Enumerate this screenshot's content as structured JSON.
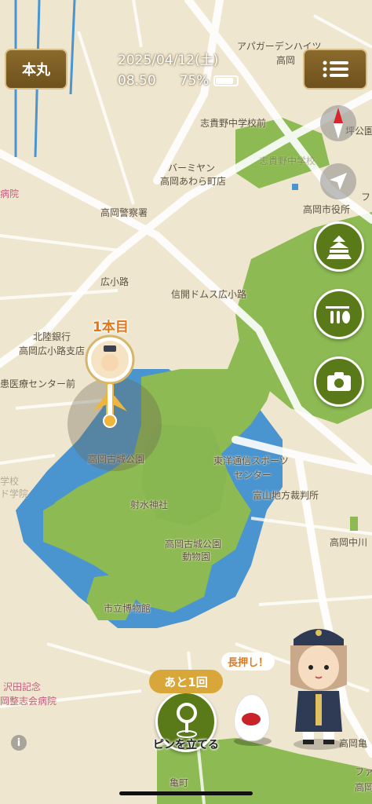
{
  "header": {
    "left_button_label": "本丸",
    "date": "2025/04/12(土)",
    "time": "08.50",
    "battery": "75%",
    "menu_icon": "list-icon"
  },
  "map_labels": {
    "apaga": "アパガーデンハイツ",
    "takaoka_top": "高岡",
    "shikino_school": "志貴野中学校前",
    "tsuboi": "坪公園",
    "shikino_school_faded": "志貴野中学校",
    "barmiyan": "バーミヤン",
    "barmiyan2": "高岡あわら町店",
    "hospital_left": "病院",
    "police": "高岡警察署",
    "city_office": "高岡市役所",
    "fa_right": "フ",
    "hirokoji": "広小路",
    "shinkai": "信開ドムス広小路",
    "hokuriku_bank": "北陸銀行",
    "hokuriku_bank2": "高岡広小路支店",
    "medical_center": "患医療センター前",
    "num_label": "1本目",
    "park": "高岡古城公園",
    "toyo": "東洋通信スポーツ",
    "toyo2": "センター",
    "school_left": "学校",
    "school_left2": "ド学院",
    "court": "富山地方裁判所",
    "imizu": "射水神社",
    "zoo": "高岡古城公園",
    "zoo2": "動物園",
    "takaoka_naka": "高岡中川",
    "museum": "市立博物館",
    "sawada": "沢田記念",
    "seishi": "岡整志会病院",
    "kamei": "高岡亀",
    "fa_bottom": "ファ",
    "bottom_town": "亀町",
    "bottom_right": "高岡"
  },
  "actions": {
    "count_badge": "あと1回",
    "pin_button": "ピンを立てる",
    "long_press": "長押し！"
  },
  "icons": {
    "compass": "compass-icon",
    "locate": "navigation-arrow-icon",
    "castle": "castle-icon",
    "pins": "pins-icon",
    "camera": "camera-icon",
    "info": "info-icon"
  },
  "colors": {
    "land": "#efe6cf",
    "park": "#8dba52",
    "water": "#4a95cf",
    "accent_green": "#5a7a1a",
    "brown_button": "#7a5c24"
  }
}
